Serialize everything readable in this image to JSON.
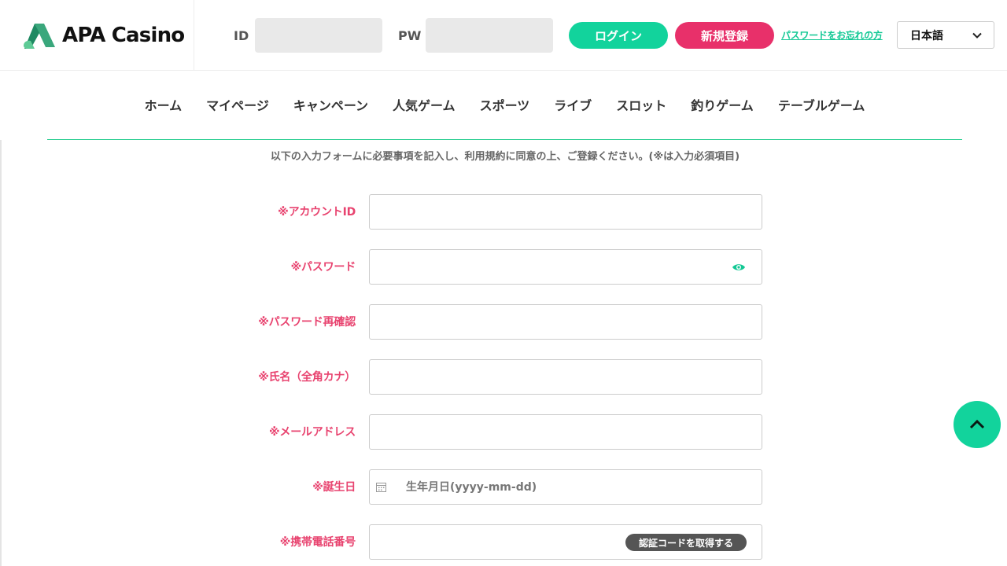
{
  "header": {
    "logo_text": "APA Casino",
    "id_label": "ID",
    "pw_label": "PW",
    "login_label": "ログイン",
    "register_label": "新規登録",
    "forgot_password": "パスワードをお忘れの方",
    "language": "日本語"
  },
  "nav": {
    "items": [
      "ホーム",
      "マイページ",
      "キャンペーン",
      "人気ゲーム",
      "スポーツ",
      "ライブ",
      "スロット",
      "釣りゲーム",
      "テーブルゲーム"
    ]
  },
  "form": {
    "intro": "以下の入力フォームに必要事項を記入し、利用規約に同意の上、ご登録ください。(※は入力必須項目)",
    "fields": {
      "account_id": "※アカウントID",
      "password": "※パスワード",
      "password_confirm": "※パスワード再確認",
      "name_kana": "※氏名（全角カナ）",
      "email": "※メールアドレス",
      "birthday": "※誕生日",
      "phone": "※携帯電話番号"
    },
    "birthday_placeholder": "生年月日(yyyy-mm-dd)",
    "get_code_label": "認証コードを取得する"
  },
  "colors": {
    "brand_green": "#12d39c",
    "brand_pink": "#e8306a",
    "label_pink": "#e8436f"
  },
  "icons": {
    "eye": "eye-icon",
    "calendar": "calendar-icon",
    "chevron": "chevron-down-icon",
    "scroll_top": "chevron-up-icon"
  }
}
